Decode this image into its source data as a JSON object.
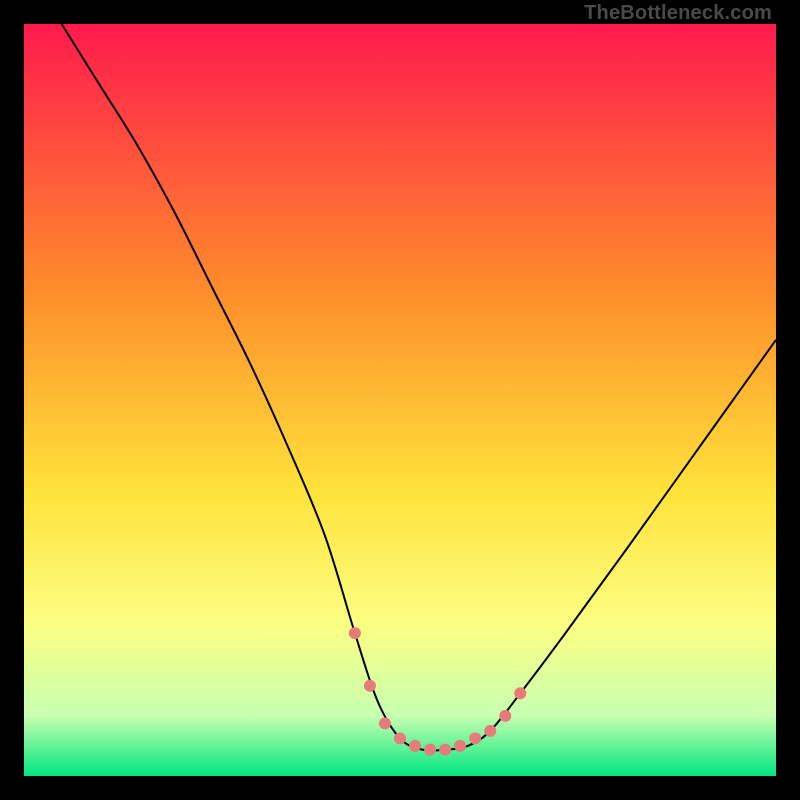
{
  "watermark": "TheBottleneck.com",
  "chart_data": {
    "type": "line",
    "title": "",
    "xlabel": "",
    "ylabel": "",
    "xlim": [
      0,
      100
    ],
    "ylim": [
      0,
      100
    ],
    "grid": false,
    "legend": false,
    "background_gradient": {
      "top": "#ff1a4d",
      "mid1": "#ff8b2b",
      "mid2": "#ffe23a",
      "mid3": "#fbff83",
      "mid4": "#c7ffb0",
      "bottom": "#00e680"
    },
    "series": [
      {
        "name": "bottleneck-curve",
        "color": "#000000",
        "width": 2,
        "x": [
          0,
          5,
          10,
          15,
          20,
          25,
          30,
          35,
          40,
          44,
          47,
          50,
          53,
          56,
          59,
          62,
          66,
          72,
          80,
          90,
          100
        ],
        "y": [
          108,
          100,
          92,
          84,
          75,
          65,
          55,
          44,
          32,
          19,
          10,
          5,
          3.5,
          3.5,
          4,
          6,
          11,
          19,
          30,
          44,
          58
        ]
      }
    ],
    "markers": {
      "name": "flat-region-markers",
      "color": "#e77b79",
      "radius": 6,
      "x": [
        44,
        46,
        48,
        50,
        52,
        54,
        56,
        58,
        60,
        62,
        64,
        66
      ],
      "y": [
        19,
        12,
        7,
        5,
        4,
        3.5,
        3.5,
        4,
        5,
        6,
        8,
        11
      ]
    }
  }
}
